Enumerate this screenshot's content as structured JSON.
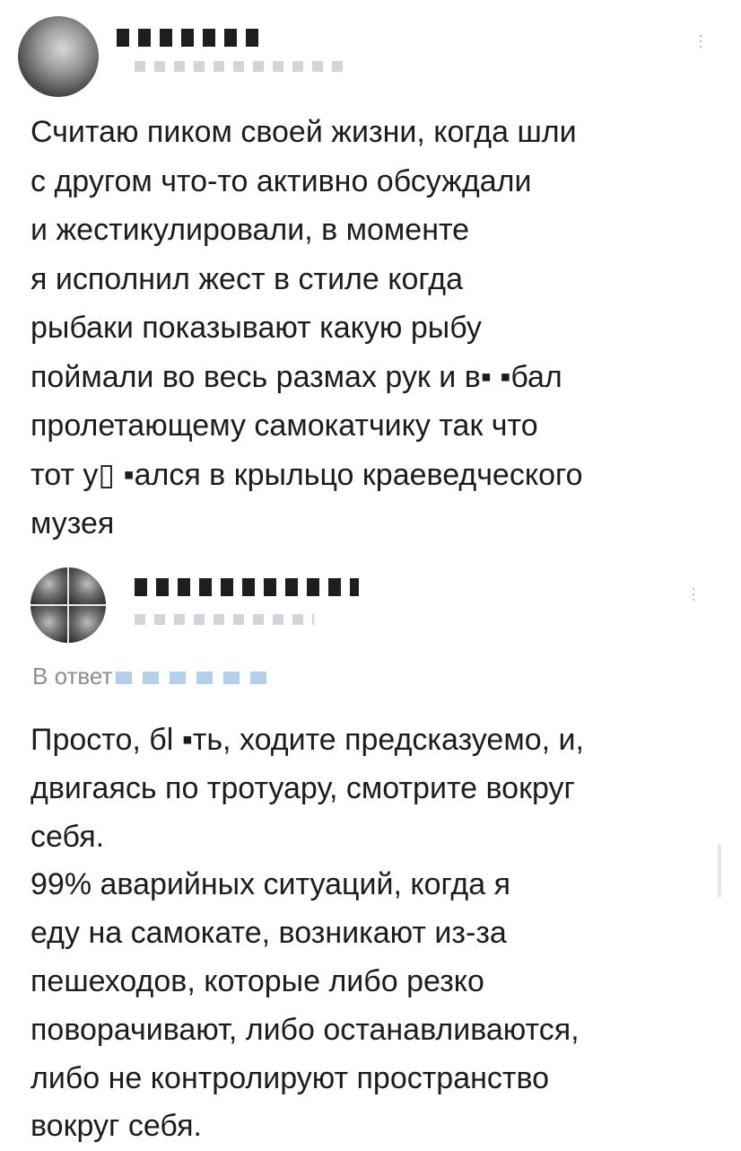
{
  "posts": [
    {
      "author_name": "",
      "author_handle": "",
      "menu_icon": "more-vertical-icon",
      "text": "Считаю пиком своей жизни, когда шли\nс другом что-то активно обсуждали\nи жестикулировали, в моменте\nя исполнил жест в стиле когда\nрыбаки показывают какую рыбу\nпоймали во весь размах рук и в▪ ▪бал\nпролетающему самокатчику так что\nтот у▯ ▪ался в крыльцо краеведческого\nмузея"
    },
    {
      "author_name": "",
      "author_handle": "",
      "menu_icon": "more-vertical-icon",
      "reply_label": "В ответ",
      "text": "Просто, бl ▪ть, ходите предсказуемо, и,\nдвигаясь по тротуару, смотрите вокруг\nсебя.\n99% аварийных ситуаций, когда я\nеду на самокате, возникают из-за\nпешеходов, которые либо резко\nповорачивают, либо останавливаются,\nлибо не контролируют пространство\nвокруг себя."
    }
  ]
}
